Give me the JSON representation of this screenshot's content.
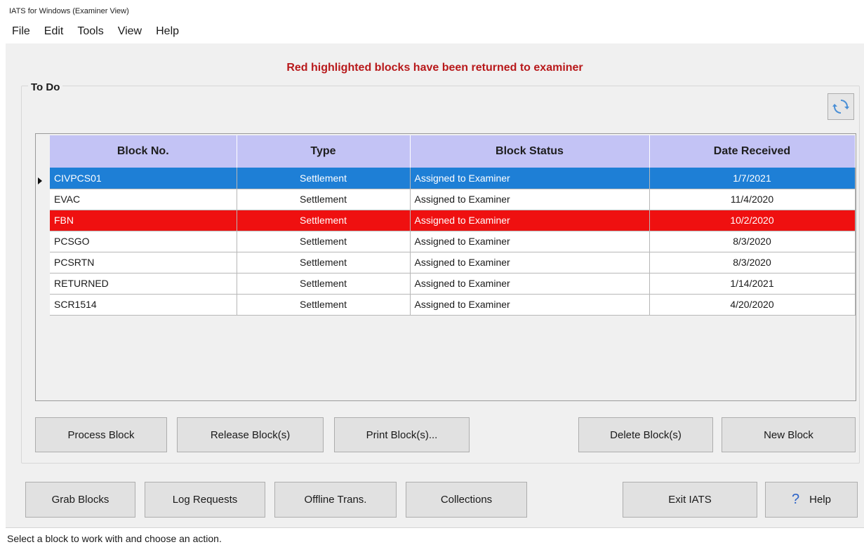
{
  "window": {
    "title": "IATS for Windows (Examiner View)"
  },
  "menu": [
    "File",
    "Edit",
    "Tools",
    "View",
    "Help"
  ],
  "banner": "Red highlighted blocks have been returned to examiner",
  "todo": {
    "label": "To Do",
    "refresh_icon": "refresh-icon",
    "columns": [
      "Block No.",
      "Type",
      "Block Status",
      "Date Received"
    ],
    "rows": [
      {
        "block_no": "CIVPCS01",
        "type": "Settlement",
        "status": "Assigned to Examiner",
        "date": "1/7/2021",
        "state": "selected"
      },
      {
        "block_no": "EVAC",
        "type": "Settlement",
        "status": "Assigned to Examiner",
        "date": "11/4/2020",
        "state": "normal"
      },
      {
        "block_no": "FBN",
        "type": "Settlement",
        "status": "Assigned to Examiner",
        "date": "10/2/2020",
        "state": "returned"
      },
      {
        "block_no": "PCSGO",
        "type": "Settlement",
        "status": "Assigned to Examiner",
        "date": "8/3/2020",
        "state": "normal"
      },
      {
        "block_no": "PCSRTN",
        "type": "Settlement",
        "status": "Assigned to Examiner",
        "date": "8/3/2020",
        "state": "normal"
      },
      {
        "block_no": "RETURNED",
        "type": "Settlement",
        "status": "Assigned to Examiner",
        "date": "1/14/2021",
        "state": "normal"
      },
      {
        "block_no": "SCR1514",
        "type": "Settlement",
        "status": "Assigned to Examiner",
        "date": "4/20/2020",
        "state": "normal"
      }
    ],
    "buttons": {
      "process": "Process Block",
      "release": "Release Block(s)",
      "print": "Print Block(s)...",
      "delete": "Delete Block(s)",
      "new": "New Block"
    }
  },
  "bottom_buttons": {
    "grab": "Grab Blocks",
    "log": "Log Requests",
    "offline": "Offline Trans.",
    "collections": "Collections",
    "exit": "Exit IATS",
    "help": "Help",
    "help_icon": "question-icon"
  },
  "status_bar": "Select a block to work with and choose an action.",
  "colors": {
    "selected_row": "#1e7fd6",
    "returned_row": "#ef1010",
    "header_bg": "#c3c3f5",
    "banner_text": "#b8191b"
  }
}
